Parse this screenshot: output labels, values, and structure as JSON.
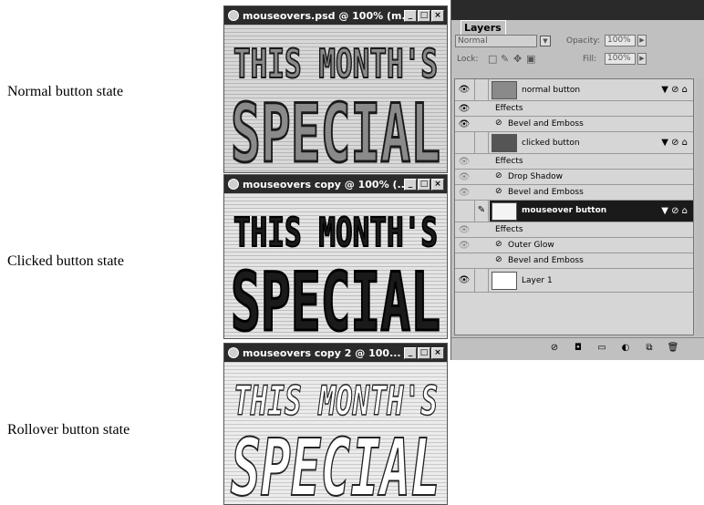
{
  "captions": {
    "normal": "Normal button state",
    "clicked": "Clicked button state",
    "rollover": "Rollover  button state"
  },
  "windows": [
    {
      "title": "mouseovers.psd @ 100% (m...",
      "line1": "THIS MONTH'S",
      "line2": "SPECIAL"
    },
    {
      "title": "mouseovers copy @ 100% (...",
      "line1": "THIS MONTH'S",
      "line2": "SPECIAL"
    },
    {
      "title": "mouseovers copy 2 @ 100...",
      "line1": "THIS MONTH'S",
      "line2": "SPECIAL"
    }
  ],
  "window_buttons": {
    "minimize": "_",
    "maximize": "□",
    "close": "×"
  },
  "layers_panel": {
    "tab": "Layers",
    "blend_mode": "Normal",
    "opacity_label": "Opacity:",
    "opacity_value": "100%",
    "lock_label": "Lock:",
    "fill_label": "Fill:",
    "fill_value": "100%",
    "rows": {
      "normal_button": "normal button",
      "effects_1": "Effects",
      "bevel_1": "Bevel and Emboss",
      "clicked_button": "clicked button",
      "effects_2": "Effects",
      "drop_shadow": "Drop Shadow",
      "bevel_2": "Bevel and Emboss",
      "mouseover_button": "mouseover button",
      "effects_3": "Effects",
      "outer_glow": "Outer Glow",
      "bevel_3": "Bevel and Emboss",
      "layer1": "Layer 1"
    }
  },
  "colors": {
    "titlebar": "#2b2b2b",
    "panel": "#c0c0c0",
    "selected_row": "#1a1a1a",
    "normal_text_fill": "#8a8a8a",
    "clicked_text_fill": "#1a1a1a",
    "rollover_text_fill": "#ffffff"
  }
}
